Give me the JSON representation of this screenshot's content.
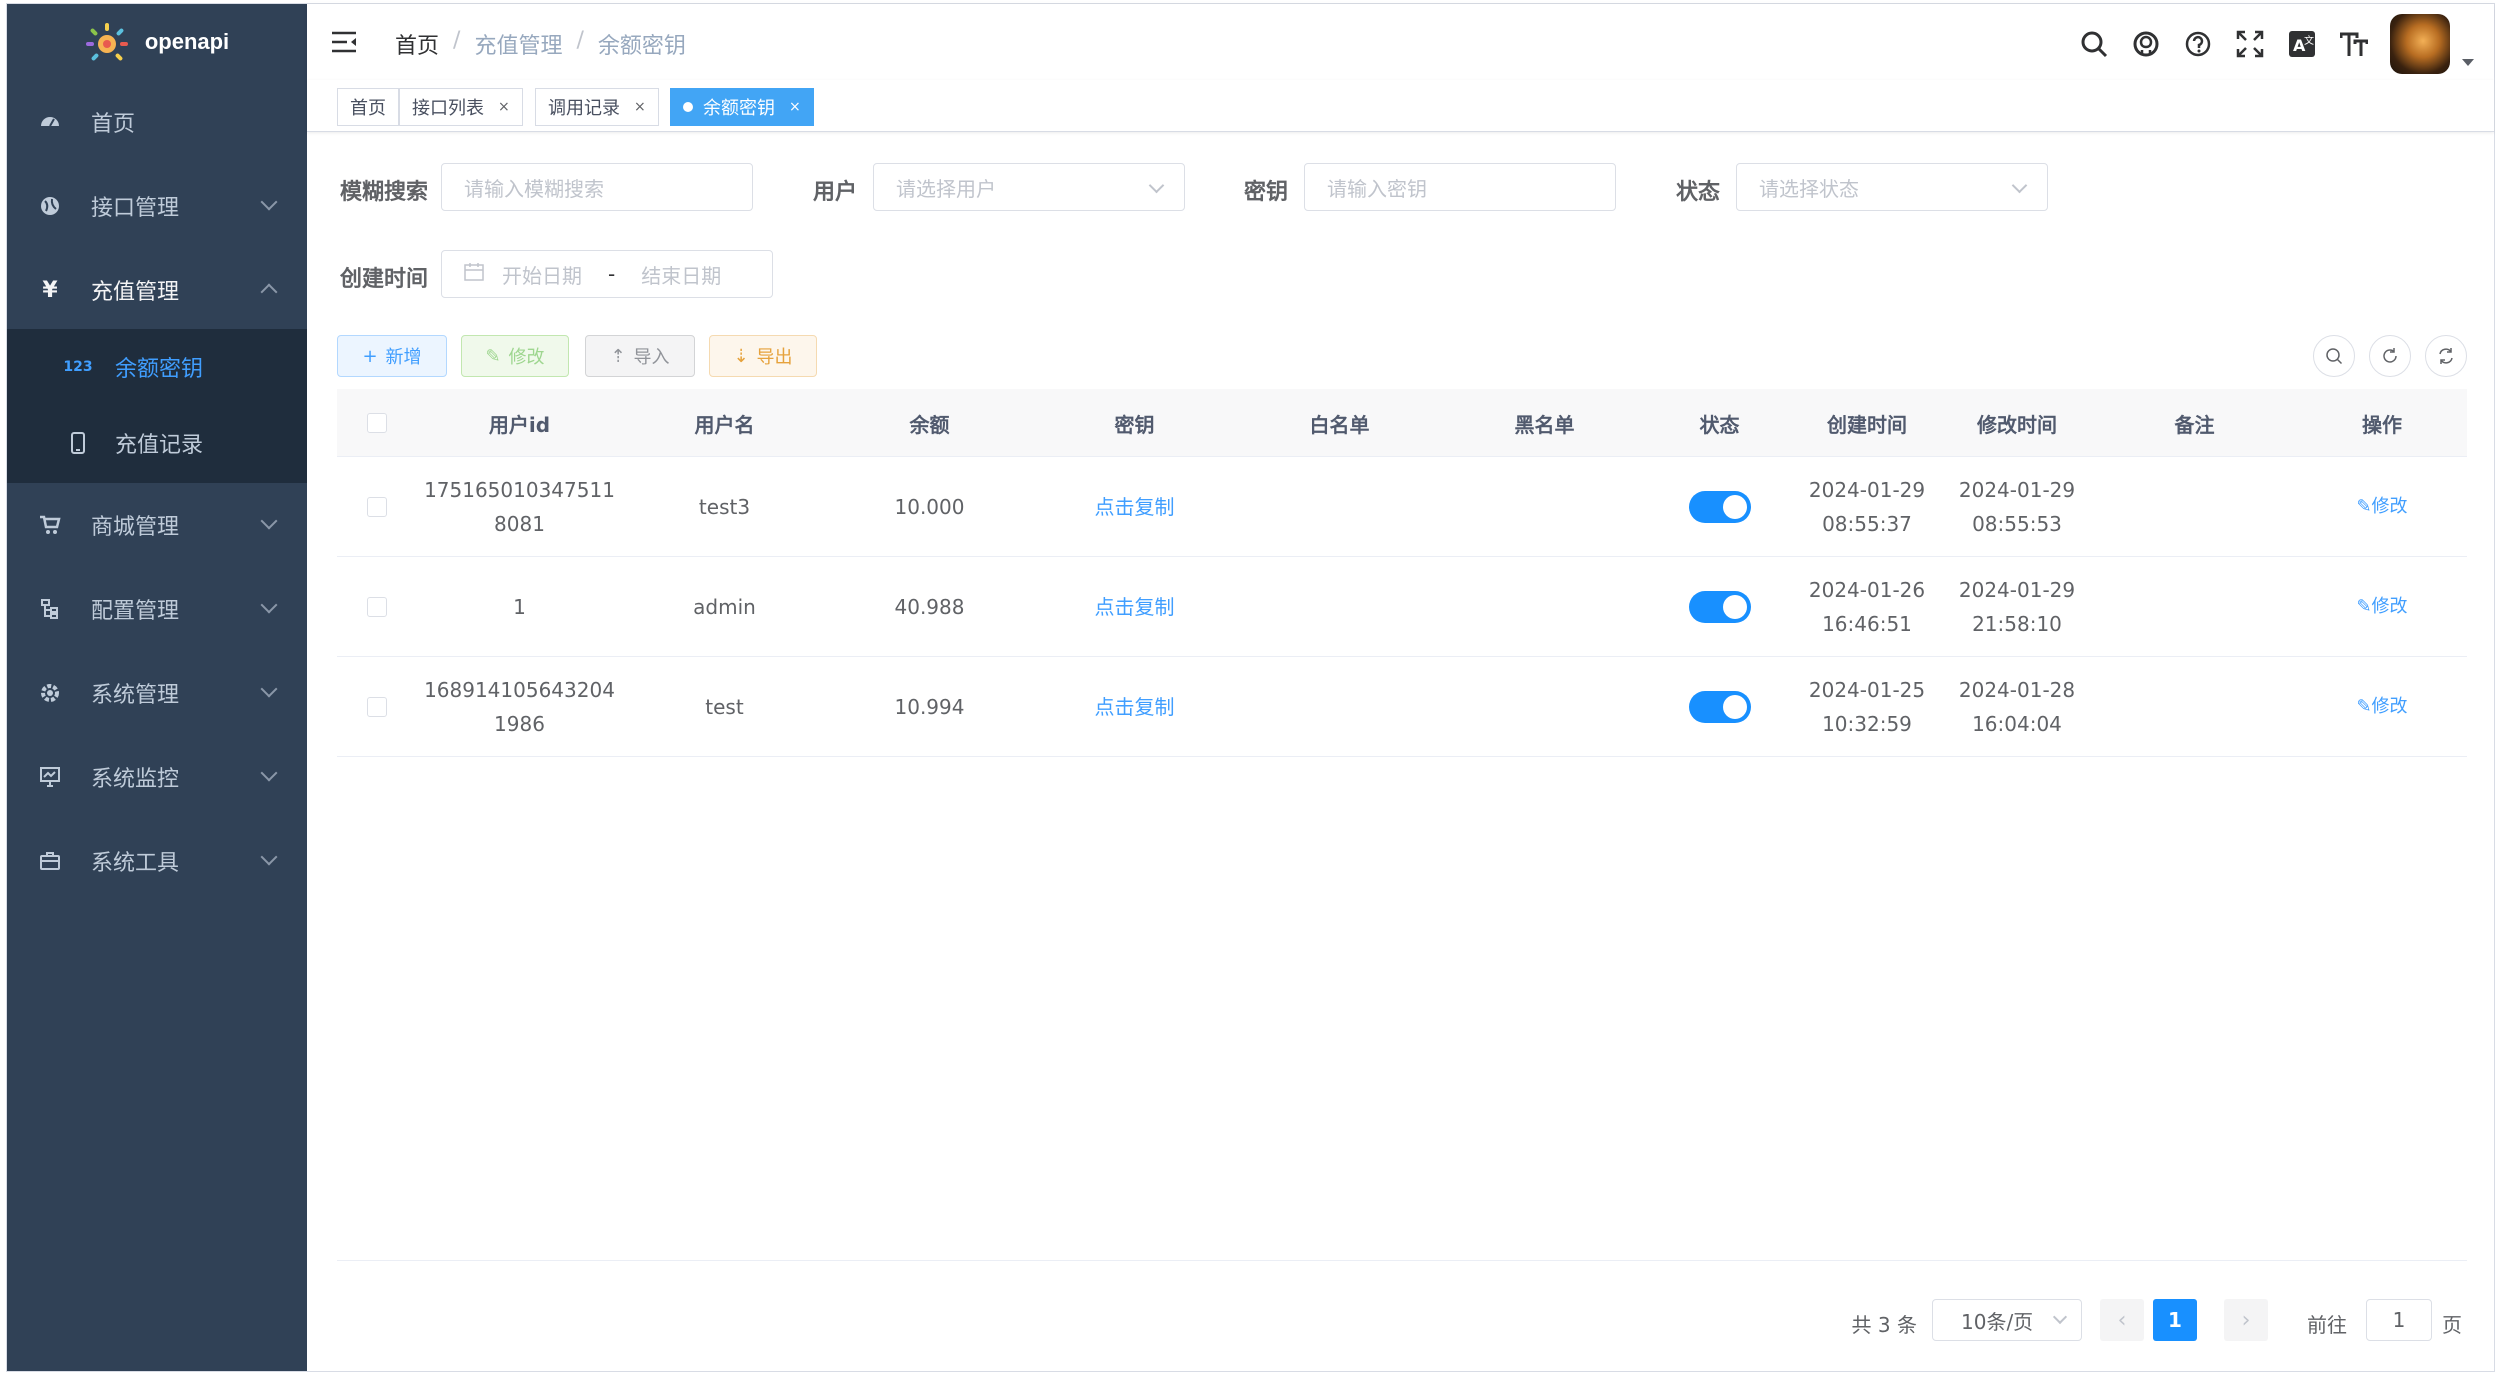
{
  "app": {
    "title": "openapi"
  },
  "sidebar": {
    "items": [
      {
        "label": "首页",
        "icon": "dashboard-icon"
      },
      {
        "label": "接口管理",
        "icon": "globe-icon"
      },
      {
        "label": "充值管理",
        "icon": "yen-icon"
      },
      {
        "label": "商城管理",
        "icon": "cart-icon"
      },
      {
        "label": "配置管理",
        "icon": "tree-icon"
      },
      {
        "label": "系统管理",
        "icon": "gear-icon"
      },
      {
        "label": "系统监控",
        "icon": "monitor-icon"
      },
      {
        "label": "系统工具",
        "icon": "toolbox-icon"
      }
    ],
    "sub_items": [
      {
        "label": "余额密钥",
        "icon": "number-icon",
        "badge": "123"
      },
      {
        "label": "充值记录",
        "icon": "phone-icon"
      }
    ]
  },
  "header": {
    "breadcrumb": [
      "首页",
      "充值管理",
      "余额密钥"
    ],
    "separator": "/"
  },
  "tags": [
    {
      "label": "首页"
    },
    {
      "label": "接口列表"
    },
    {
      "label": "调用记录"
    },
    {
      "label": "余额密钥"
    }
  ],
  "close_glyph": "×",
  "search": {
    "fuzzy_label": "模糊搜索",
    "fuzzy_placeholder": "请输入模糊搜索",
    "user_label": "用户",
    "user_placeholder": "请选择用户",
    "key_label": "密钥",
    "key_placeholder": "请输入密钥",
    "status_label": "状态",
    "status_placeholder": "请选择状态",
    "created_label": "创建时间",
    "start_placeholder": "开始日期",
    "range_sep": "-",
    "end_placeholder": "结束日期"
  },
  "toolbar": {
    "add": "新增",
    "edit": "修改",
    "import": "导入",
    "export": "导出"
  },
  "table": {
    "columns": [
      "用户id",
      "用户名",
      "余额",
      "密钥",
      "白名单",
      "黑名单",
      "状态",
      "创建时间",
      "修改时间",
      "备注",
      "操作"
    ],
    "rows": [
      {
        "id_line1": "175165010347511",
        "id_line2": "8081",
        "name": "test3",
        "balance": "10.000",
        "key": "点击复制",
        "whitelist": "",
        "blacklist": "",
        "status_on": true,
        "created_date": "2024-01-29",
        "created_time": "08:55:37",
        "updated_date": "2024-01-29",
        "updated_time": "08:55:53",
        "remark": "",
        "action": "修改"
      },
      {
        "id_line1": "1",
        "id_line2": "",
        "name": "admin",
        "balance": "40.988",
        "key": "点击复制",
        "whitelist": "",
        "blacklist": "",
        "status_on": true,
        "created_date": "2024-01-26",
        "created_time": "16:46:51",
        "updated_date": "2024-01-29",
        "updated_time": "21:58:10",
        "remark": "",
        "action": "修改"
      },
      {
        "id_line1": "168914105643204",
        "id_line2": "1986",
        "name": "test",
        "balance": "10.994",
        "key": "点击复制",
        "whitelist": "",
        "blacklist": "",
        "status_on": true,
        "created_date": "2024-01-25",
        "created_time": "10:32:59",
        "updated_date": "2024-01-28",
        "updated_time": "16:04:04",
        "remark": "",
        "action": "修改"
      }
    ]
  },
  "pagination": {
    "total": "共 3 条",
    "page_size": "10条/页",
    "current_page": "1",
    "goto_label": "前往",
    "goto_value": "1",
    "page_unit": "页"
  },
  "colors": {
    "sidebar_bg": "#304156",
    "submenu_bg": "#1f2d3d",
    "accent": "#409eff",
    "switch_on": "#1890ff"
  }
}
